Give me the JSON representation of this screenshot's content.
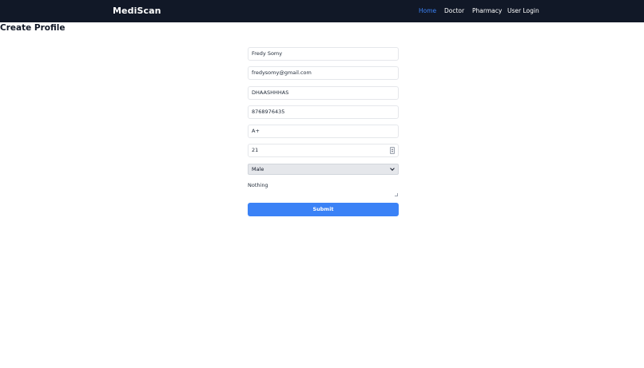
{
  "navbar": {
    "brand": "MediScan",
    "links": [
      {
        "label": "Home",
        "active": true
      },
      {
        "label": "Doctor",
        "active": false
      },
      {
        "label": "Pharmacy",
        "active": false
      },
      {
        "label": "User Login",
        "active": false
      }
    ]
  },
  "page": {
    "title": "Create Profile"
  },
  "form": {
    "name": "Fredy Somy",
    "email": "fredysomy@gmail.com",
    "id_number": "DHAASHHHAS",
    "phone": "8768976435",
    "blood_group": "A+",
    "age": "21",
    "gender": "Male",
    "notes": "Nothing",
    "submit_label": "Submit"
  },
  "colors": {
    "navbar_bg": "#111827",
    "accent": "#3b82f6",
    "select_bg": "#e5e7eb"
  },
  "icons": {
    "select_chevron": "chevron-down-icon",
    "age_stepper": "stepper-icon",
    "textarea_resize": "resize-handle-icon"
  }
}
